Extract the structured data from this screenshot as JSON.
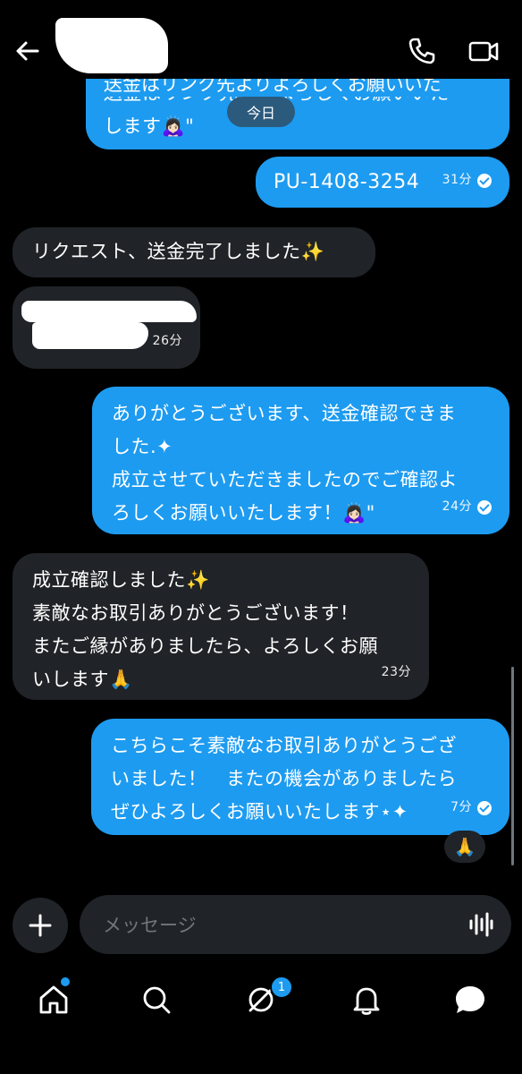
{
  "header": {
    "contact_name": "",
    "back_label": "back",
    "call_label": "call",
    "video_label": "video"
  },
  "date_separator": "今日",
  "messages": [
    {
      "dir": "out",
      "lines": [
        "送金はリンク先よりよろしくお願いいた",
        "します🙇🏻‍♀️\""
      ],
      "time": "",
      "read": false
    },
    {
      "dir": "out",
      "lines": [
        "PU-1408-3254"
      ],
      "time": "31分",
      "read": true
    },
    {
      "dir": "in",
      "lines": [
        "リクエスト、送金完了しました✨"
      ],
      "time": "",
      "read": false
    },
    {
      "dir": "in",
      "lines": [
        ""
      ],
      "time": "26分",
      "read": false
    },
    {
      "dir": "out",
      "lines": [
        "ありがとうございます、送金確認できま",
        "した.✦",
        "成立させていただきましたのでご確認よ",
        "ろしくお願いいたします！🙇🏻‍♀️\""
      ],
      "time": "24分",
      "read": true
    },
    {
      "dir": "in",
      "lines": [
        "成立確認しました✨",
        "素敵なお取引ありがとうございます！",
        "またご縁がありましたら、よろしくお願",
        "いします🙏"
      ],
      "time": "23分",
      "read": false
    },
    {
      "dir": "out",
      "lines": [
        "こちらこそ素敵なお取引ありがとうござ",
        "いました！　またの機会がありましたら",
        "ぜひよろしくお願いいたします⋆✦"
      ],
      "time": "7分",
      "read": true
    }
  ],
  "reaction": "🙏",
  "composer": {
    "placeholder": "メッセージ",
    "add_label": "+"
  },
  "tabbar": {
    "items": [
      "home",
      "search",
      "grok",
      "notifications",
      "messages"
    ],
    "grok_badge": "1"
  },
  "colors": {
    "accent": "#1d9bf0",
    "incoming_bubble": "#202327",
    "background": "#000000"
  }
}
